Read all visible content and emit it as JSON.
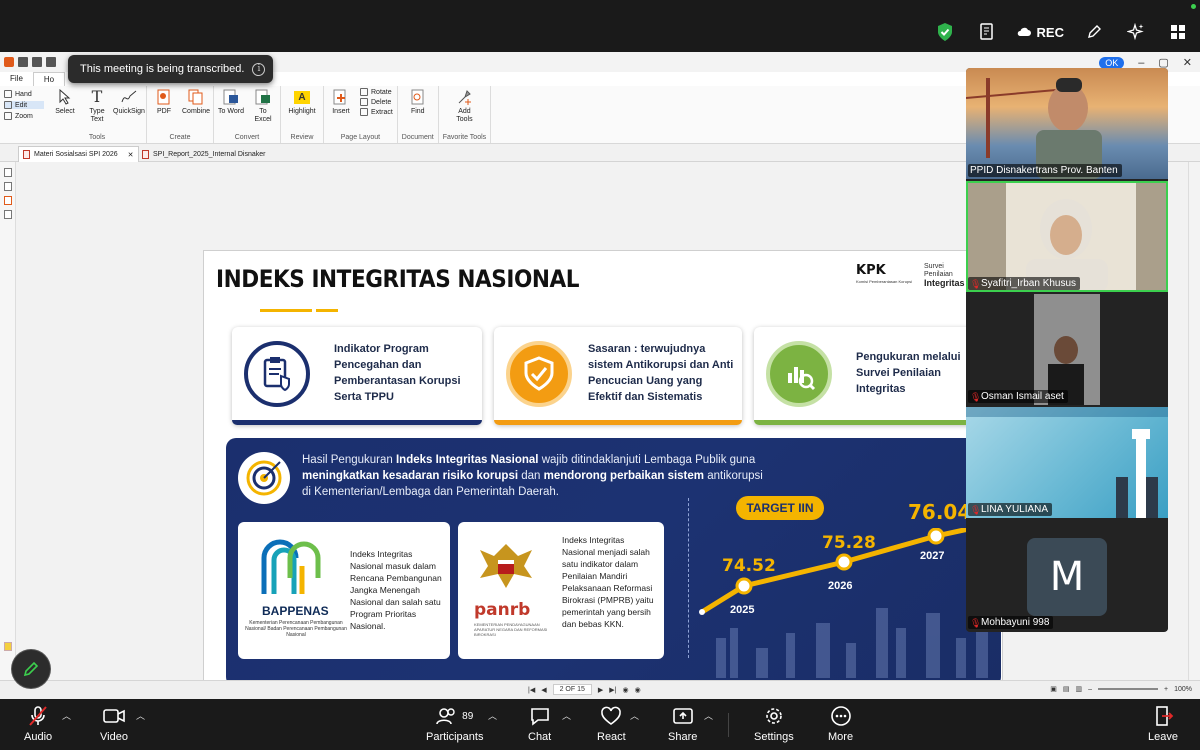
{
  "zoom_top": {
    "rec_label": "REC"
  },
  "banner": {
    "text": "This meeting is being transcribed."
  },
  "pdf_app": {
    "menu_tabs": [
      "File",
      "Ho"
    ],
    "ok_label": "OK",
    "modes": [
      "Hand",
      "Edit",
      "Zoom"
    ],
    "ribbon": {
      "tools": {
        "label": "Tools",
        "items": [
          "Select",
          "Type Text",
          "QuickSign"
        ]
      },
      "create": {
        "label": "Create",
        "items": [
          "PDF",
          "Combine"
        ]
      },
      "convert": {
        "label": "Convert",
        "items": [
          "To Word",
          "To Excel"
        ]
      },
      "review": {
        "label": "Review",
        "items": [
          "Highlight"
        ]
      },
      "page_layout": {
        "label": "Page Layout",
        "insert": "Insert",
        "small": [
          "Rotate",
          "Delete",
          "Extract"
        ]
      },
      "document": {
        "label": "Document",
        "items": [
          "Find"
        ]
      },
      "favorite": {
        "label": "Favorite Tools",
        "items": [
          "Add Tools"
        ]
      }
    },
    "doc_tabs": [
      "Materi Sosialsasi SPI 2026",
      "SPI_Report_2025_Internal Disnaker"
    ],
    "status": {
      "page": "2 OF 15",
      "zoom": "100%"
    }
  },
  "slide": {
    "title": "INDEKS INTEGRITAS NASIONAL",
    "kpk": "KPK",
    "kpk_sub": "Komisi Pemberantasan Korupsi",
    "survei_line1": "Survei",
    "survei_line2": "Penilaian",
    "survei_line3": "Integritas",
    "cards": [
      {
        "text": "Indikator Program Pencegahan dan Pemberantasan Korupsi Serta TPPU",
        "color": "#1b2f6e"
      },
      {
        "text": "Sasaran : terwujudnya sistem Antikorupsi dan Anti Pencucian Uang yang Efektif dan Sistematis",
        "color": "#f39c12"
      },
      {
        "text": "Pengukuran melalui Survei Penilaian Integritas",
        "color": "#7cb342"
      }
    ],
    "navy": {
      "t1": "Hasil Pengukuran ",
      "b1": "Indeks Integritas Nasional",
      "t2": " wajib ditindaklanjuti Lembaga Publik guna ",
      "b2": "meningkatkan kesadaran risiko korupsi",
      "t3": " dan ",
      "b3": "mendorong perbaikan sistem",
      "t4": " antikorupsi di Kementerian/Lembaga dan Pemerintah Daerah."
    },
    "bappenas": {
      "name": "BAPPENAS",
      "sub": "Kementerian Perencanaan Pembangunan Nasional/ Badan Perencanaan Pembangunan Nasional",
      "text": "Indeks Integritas Nasional masuk dalam Rencana Pembangunan Jangka Menengah Nasional dan salah satu Program Prioritas Nasional."
    },
    "panrb": {
      "name": "panrb",
      "sub": "KEMENTERIAN PENDAYAGUNAAN APARATUR NEGARA DAN REFORMASI BIROKRASI",
      "text": "Indeks Integritas Nasional menjadi salah satu indikator dalam Penilaian Mandiri Pelaksanaan Reformasi Birokrasi (PMPRB) yaitu pemerintah yang bersih dan bebas KKN."
    },
    "target_label": "TARGET IIN",
    "targets": [
      {
        "year": "2025",
        "value": "74.52"
      },
      {
        "year": "2026",
        "value": "75.28"
      },
      {
        "year": "2027",
        "value": "76.04"
      }
    ]
  },
  "participants_panel": [
    {
      "name": "PPID Disnakertrans Prov. Banten",
      "muted": false
    },
    {
      "name": "Syafitri_Irban Khusus",
      "muted": true,
      "active": true
    },
    {
      "name": "Osman Ismail aset",
      "muted": true
    },
    {
      "name": "LINA YULIANA",
      "muted": true
    },
    {
      "name": "Mohbayuni 998",
      "muted": true,
      "initial": "M"
    }
  ],
  "zoom_bar": {
    "audio": "Audio",
    "video": "Video",
    "participants": "Participants",
    "participants_count": "89",
    "chat": "Chat",
    "react": "React",
    "share": "Share",
    "settings": "Settings",
    "more": "More",
    "leave": "Leave"
  },
  "colors": {
    "navy": "#1b2f6e",
    "gold": "#f4b400",
    "active_border": "#3ccf4e"
  }
}
